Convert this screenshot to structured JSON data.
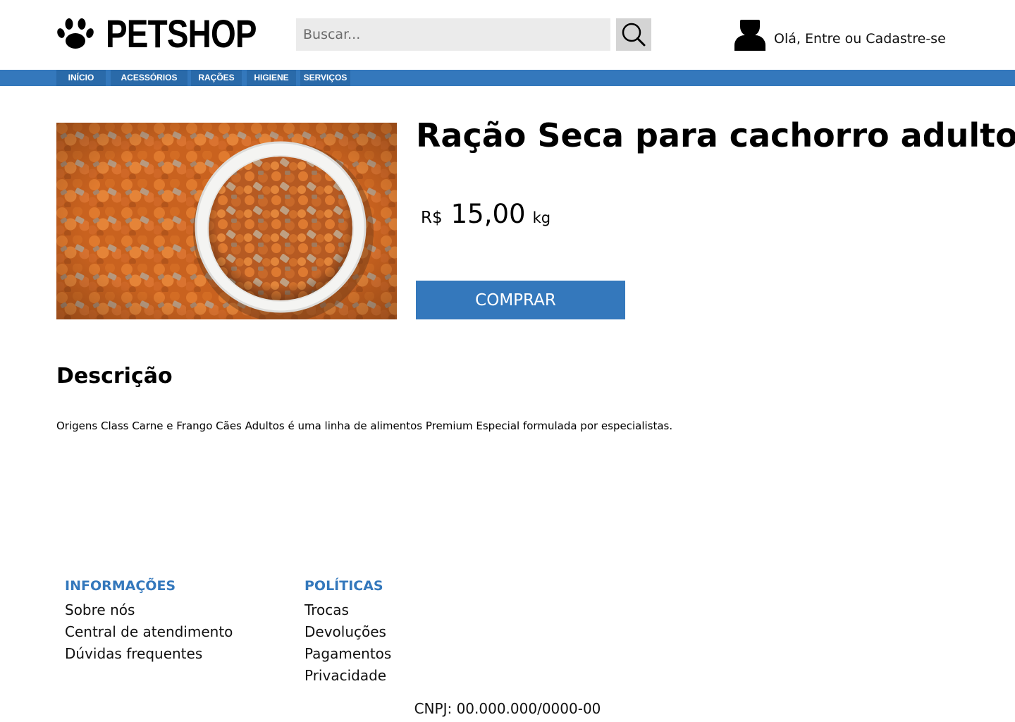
{
  "header": {
    "brand": "PETSHOP",
    "search_placeholder": "Buscar...",
    "login_text": "Olá, Entre ou Cadastre-se"
  },
  "nav": {
    "items": [
      {
        "label": "INÍCIO"
      },
      {
        "label": "ACESSÓRIOS"
      },
      {
        "label": "RAÇÕES"
      },
      {
        "label": "HIGIENE"
      },
      {
        "label": "SERVIÇOS"
      }
    ]
  },
  "product": {
    "title": "Ração Seca para cachorro adulto",
    "currency": "R$",
    "price": "15,00",
    "unit": "kg",
    "buy_label": "COMPRAR"
  },
  "description": {
    "heading": "Descrição",
    "text": "Origens Class Carne e Frango Cães Adultos é uma linha de alimentos Premium Especial formulada por especialistas."
  },
  "footer": {
    "info": {
      "title": "INFORMAÇÕES",
      "links": [
        "Sobre nós",
        "Central de atendimento",
        "Dúvidas frequentes"
      ]
    },
    "policies": {
      "title": "POLÍTICAS",
      "links": [
        "Trocas",
        "Devoluções",
        "Pagamentos",
        "Privacidade"
      ]
    },
    "cnpj": "CNPJ: 00.000.000/0000-00"
  },
  "colors": {
    "accent": "#3478bc",
    "nav_item": "#2a6aa9",
    "search_bg": "#ebebeb",
    "search_button": "#d4d4d4"
  },
  "icons": [
    "paw-icon",
    "search-icon",
    "user-icon"
  ]
}
